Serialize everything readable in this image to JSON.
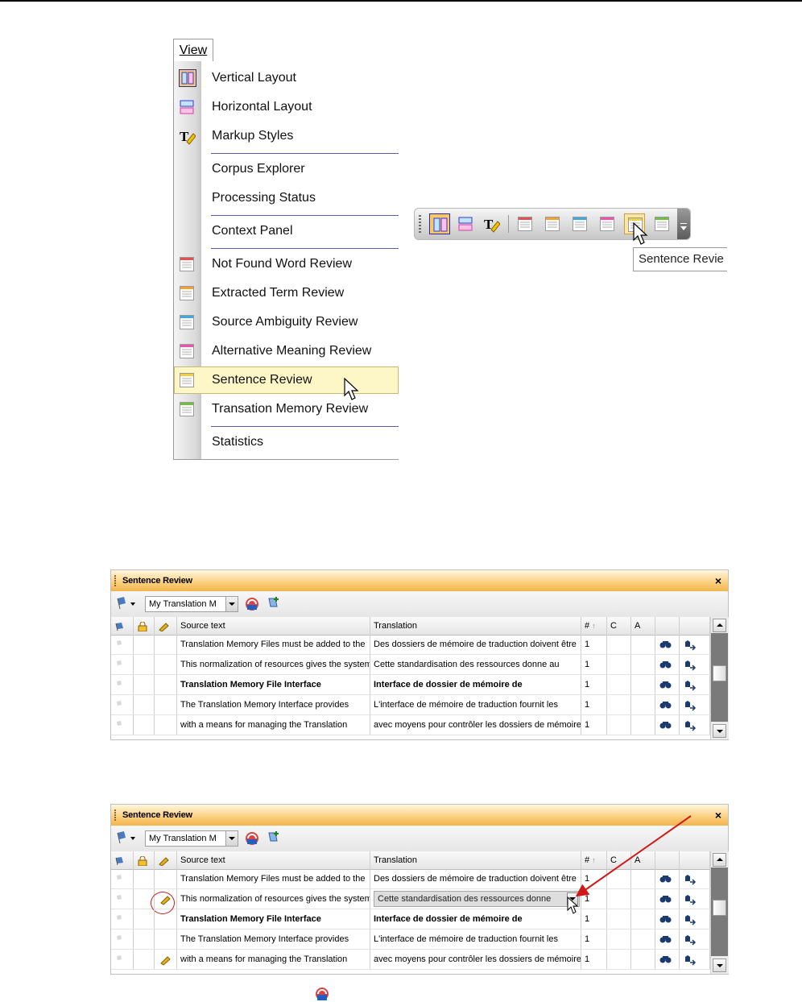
{
  "view_menu": {
    "title": "View",
    "items": [
      {
        "label": "Vertical Layout",
        "icon": "vertical-layout-icon"
      },
      {
        "label": "Horizontal Layout",
        "icon": "horizontal-layout-icon"
      },
      {
        "label": "Markup Styles",
        "icon": "markup-styles-icon"
      },
      {
        "label": "Corpus Explorer",
        "icon": ""
      },
      {
        "label": "Processing Status",
        "icon": ""
      },
      {
        "label": "Context Panel",
        "icon": ""
      },
      {
        "label": "Not Found Word Review",
        "icon": "review-red-icon"
      },
      {
        "label": "Extracted Term Review",
        "icon": "review-orange-icon"
      },
      {
        "label": "Source Ambiguity Review",
        "icon": "review-blue-icon"
      },
      {
        "label": "Alternative Meaning Review",
        "icon": "review-pink-icon"
      },
      {
        "label": "Sentence Review",
        "icon": "review-yellow-icon",
        "highlighted": true
      },
      {
        "label": "Transation Memory Review",
        "icon": "review-green-icon"
      },
      {
        "label": "Statistics",
        "icon": ""
      }
    ]
  },
  "toolbar": {
    "tooltip": "Sentence Revie",
    "active_button": "vertical-layout",
    "hovered_button": "sentence-review"
  },
  "sentence_review": {
    "title": "Sentence Review",
    "close": "×",
    "tm_combo": "My Translation M",
    "columns": [
      "Source text",
      "Translation",
      "#",
      "C",
      "A"
    ],
    "sort_glyph": "↑",
    "rows": [
      {
        "source": "Translation Memory Files must be added to the",
        "translation": "Des dossiers de mémoire de traduction doivent être",
        "count": "1",
        "bold": false
      },
      {
        "source": "This normalization of resources gives the system",
        "translation": "Cette standardisation des ressources donne au",
        "count": "1",
        "bold": false
      },
      {
        "source": "Translation Memory File Interface",
        "translation": "Interface de dossier de mémoire de",
        "count": "1",
        "bold": true
      },
      {
        "source": "The Translation Memory Interface provides",
        "translation": "L'interface de mémoire de traduction fournit les",
        "count": "1",
        "bold": false
      },
      {
        "source": "with a means for managing the Translation",
        "translation": "avec moyens pour contrôler les dossiers de mémoire",
        "count": "1",
        "bold": false
      }
    ],
    "edit_value": "Cette standardisation des ressources donne"
  },
  "colors": {
    "title_orange": "#f2b34c",
    "menu_highlight": "#fdf7c8",
    "separator": "#5c5ca8",
    "annotation_red": "#d01818"
  }
}
